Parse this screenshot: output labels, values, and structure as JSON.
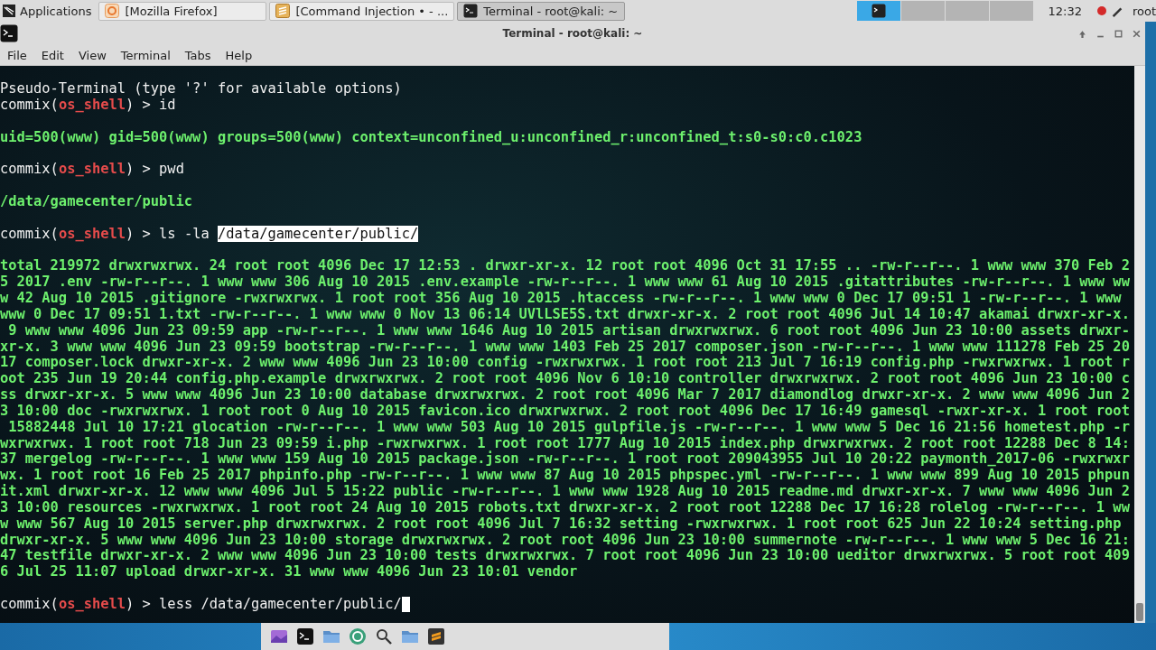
{
  "top_panel": {
    "menu": "Applications",
    "tasks": [
      {
        "label": "[Mozilla Firefox]",
        "kind": "browser",
        "selected": false
      },
      {
        "label": "[Command Injection • - ...",
        "kind": "editor",
        "selected": false
      },
      {
        "label": "Terminal - root@kali: ~",
        "kind": "terminal",
        "selected": true
      }
    ],
    "workspaces": [
      {
        "selected": true
      },
      {
        "selected": false
      },
      {
        "selected": false
      },
      {
        "selected": false
      }
    ],
    "clock": "12:32",
    "user": "root"
  },
  "window": {
    "title": "Terminal - root@kali: ~",
    "menu": [
      "File",
      "Edit",
      "View",
      "Terminal",
      "Tabs",
      "Help"
    ]
  },
  "terminal": {
    "lines": [
      {
        "kind": "text",
        "text": "Pseudo-Terminal (type '?' for available options)"
      },
      {
        "kind": "prompt",
        "prefix": "commix(",
        "shell": "os_shell",
        "suffix": ") > ",
        "command": "id"
      },
      {
        "kind": "blank"
      },
      {
        "kind": "output",
        "text": "uid=500(www) gid=500(www) groups=500(www) context=unconfined_u:unconfined_r:unconfined_t:s0-s0:c0.c1023"
      },
      {
        "kind": "blank"
      },
      {
        "kind": "prompt",
        "prefix": "commix(",
        "shell": "os_shell",
        "suffix": ") > ",
        "command": "pwd"
      },
      {
        "kind": "blank"
      },
      {
        "kind": "output",
        "text": "/data/gamecenter/public"
      },
      {
        "kind": "blank"
      },
      {
        "kind": "prompt",
        "prefix": "commix(",
        "shell": "os_shell",
        "suffix": ") > ",
        "command": "ls -la ",
        "selection": "/data/gamecenter/public/"
      },
      {
        "kind": "blank"
      },
      {
        "kind": "output",
        "text": "total 219972 drwxrwxrwx. 24 root root 4096 Dec 17 12:53 . drwxr-xr-x. 12 root root 4096 Oct 31 17:55 .. -rw-r--r--. 1 www www 370 Feb 2"
      },
      {
        "kind": "output",
        "text": "5 2017 .env -rw-r--r--. 1 www www 306 Aug 10 2015 .env.example -rw-r--r--. 1 www www 61 Aug 10 2015 .gitattributes -rw-r--r--. 1 www ww"
      },
      {
        "kind": "output",
        "text": "w 42 Aug 10 2015 .gitignore -rwxrwxrwx. 1 root root 356 Aug 10 2015 .htaccess -rw-r--r--. 1 www www 0 Dec 17 09:51 1 -rw-r--r--. 1 www"
      },
      {
        "kind": "output",
        "text": "www 0 Dec 17 09:51 1.txt -rw-r--r--. 1 www www 0 Nov 13 06:14 UVlLSE5S.txt drwxr-xr-x. 2 root root 4096 Jul 14 10:47 akamai drwxr-xr-x."
      },
      {
        "kind": "output",
        "text": " 9 www www 4096 Jun 23 09:59 app -rw-r--r--. 1 www www 1646 Aug 10 2015 artisan drwxrwxrwx. 6 root root 4096 Jun 23 10:00 assets drwxr-"
      },
      {
        "kind": "output",
        "text": "xr-x. 3 www www 4096 Jun 23 09:59 bootstrap -rw-r--r--. 1 www www 1403 Feb 25 2017 composer.json -rw-r--r--. 1 www www 111278 Feb 25 20"
      },
      {
        "kind": "output",
        "text": "17 composer.lock drwxr-xr-x. 2 www www 4096 Jun 23 10:00 config -rwxrwxrwx. 1 root root 213 Jul 7 16:19 config.php -rwxrwxrwx. 1 root r"
      },
      {
        "kind": "output",
        "text": "oot 235 Jun 19 20:44 config.php.example drwxrwxrwx. 2 root root 4096 Nov 6 10:10 controller drwxrwxrwx. 2 root root 4096 Jun 23 10:00 c"
      },
      {
        "kind": "output",
        "text": "ss drwxr-xr-x. 5 www www 4096 Jun 23 10:00 database drwxrwxrwx. 2 root root 4096 Mar 7 2017 diamondlog drwxr-xr-x. 2 www www 4096 Jun 2"
      },
      {
        "kind": "output",
        "text": "3 10:00 doc -rwxrwxrwx. 1 root root 0 Aug 10 2015 favicon.ico drwxrwxrwx. 2 root root 4096 Dec 17 16:49 gamesql -rwxr-xr-x. 1 root root"
      },
      {
        "kind": "output",
        "text": " 15882448 Jul 10 17:21 glocation -rw-r--r--. 1 www www 503 Aug 10 2015 gulpfile.js -rw-r--r--. 1 www www 5 Dec 16 21:56 hometest.php -r"
      },
      {
        "kind": "output",
        "text": "wxrwxrwx. 1 root root 718 Jun 23 09:59 i.php -rwxrwxrwx. 1 root root 1777 Aug 10 2015 index.php drwxrwxrwx. 2 root root 12288 Dec 8 14:"
      },
      {
        "kind": "output",
        "text": "37 mergelog -rw-r--r--. 1 www www 159 Aug 10 2015 package.json -rw-r--r--. 1 root root 209043955 Jul 10 20:22 paymonth_2017-06 -rwxrwxr"
      },
      {
        "kind": "output",
        "text": "wx. 1 root root 16 Feb 25 2017 phpinfo.php -rw-r--r--. 1 www www 87 Aug 10 2015 phpspec.yml -rw-r--r--. 1 www www 899 Aug 10 2015 phpun"
      },
      {
        "kind": "output",
        "text": "it.xml drwxr-xr-x. 12 www www 4096 Jul 5 15:22 public -rw-r--r--. 1 www www 1928 Aug 10 2015 readme.md drwxr-xr-x. 7 www www 4096 Jun 2"
      },
      {
        "kind": "output",
        "text": "3 10:00 resources -rwxrwxrwx. 1 root root 24 Aug 10 2015 robots.txt drwxr-xr-x. 2 root root 12288 Dec 17 16:28 rolelog -rw-r--r--. 1 ww"
      },
      {
        "kind": "output",
        "text": "w www 567 Aug 10 2015 server.php drwxrwxrwx. 2 root root 4096 Jul 7 16:32 setting -rwxrwxrwx. 1 root root 625 Jun 22 10:24 setting.php"
      },
      {
        "kind": "output",
        "text": "drwxr-xr-x. 5 www www 4096 Jun 23 10:00 storage drwxrwxrwx. 2 root root 4096 Jun 23 10:00 summernote -rw-r--r--. 1 www www 5 Dec 16 21:"
      },
      {
        "kind": "output",
        "text": "47 testfile drwxr-xr-x. 2 www www 4096 Jun 23 10:00 tests drwxrwxrwx. 7 root root 4096 Jun 23 10:00 ueditor drwxrwxrwx. 5 root root 409"
      },
      {
        "kind": "output",
        "text": "6 Jul 25 11:07 upload drwxr-xr-x. 31 www www 4096 Jun 23 10:01 vendor"
      },
      {
        "kind": "blank"
      },
      {
        "kind": "prompt",
        "prefix": "commix(",
        "shell": "os_shell",
        "suffix": ") > ",
        "command": "less /data/gamecenter/public/",
        "cursor": true
      }
    ]
  },
  "dock": {
    "apps": [
      {
        "kind": "image"
      },
      {
        "kind": "terminal"
      },
      {
        "kind": "folder"
      },
      {
        "kind": "globe"
      },
      {
        "kind": "search"
      },
      {
        "kind": "folder"
      },
      {
        "kind": "editor"
      }
    ]
  }
}
